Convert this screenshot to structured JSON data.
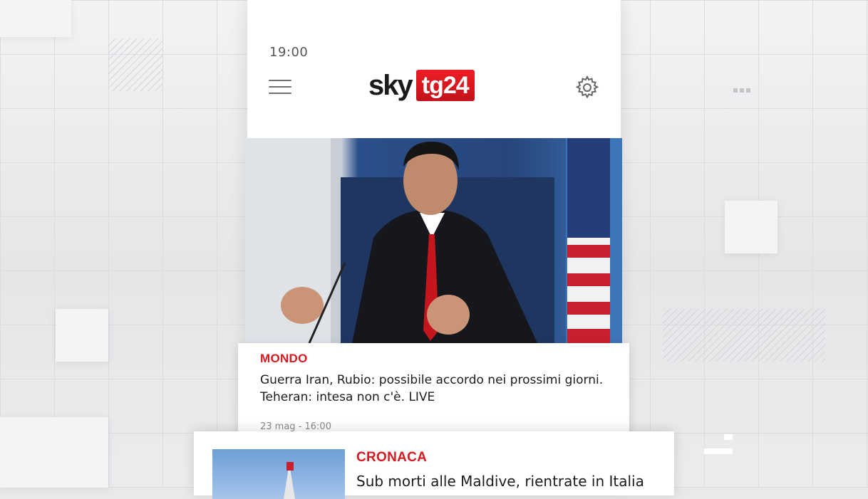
{
  "status_bar": {
    "time": "19:00"
  },
  "header": {
    "logo_sky": "sky",
    "logo_tg": "tg24",
    "menu_icon": "hamburger-menu-icon",
    "settings_icon": "gear-icon"
  },
  "articles": [
    {
      "category": "MONDO",
      "headline": "Guerra Iran, Rubio: possibile accordo nei prossimi giorni. Teheran: intesa non c'è. LIVE",
      "date": "23 mag - 16:00"
    },
    {
      "category": "CRONACA",
      "headline": "Sub morti alle Maldive, rientrate in Italia"
    }
  ],
  "colors": {
    "accent_red": "#d71920",
    "logo_red": "#ee1c24",
    "background": "#e9e9eb"
  }
}
